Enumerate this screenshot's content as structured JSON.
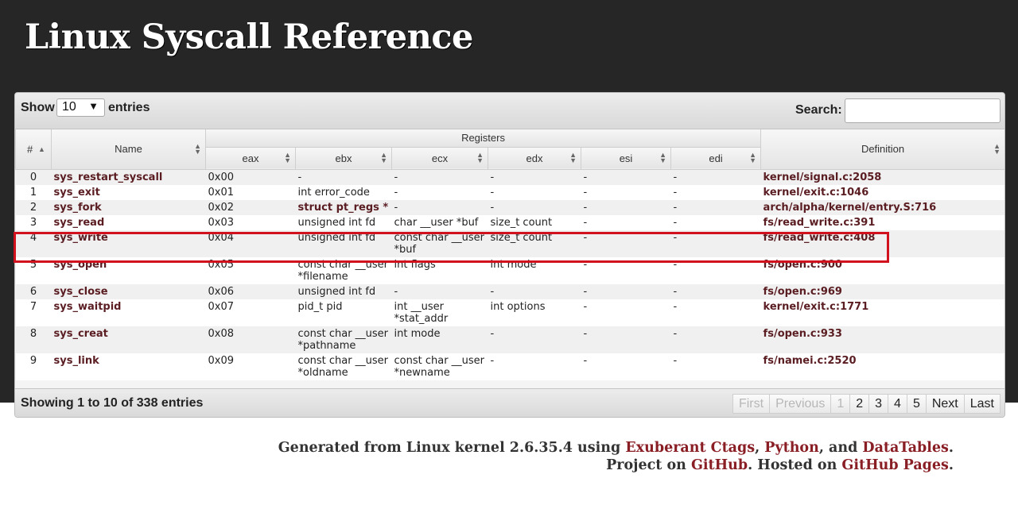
{
  "site": {
    "title": "Linux Syscall Reference"
  },
  "toolbar": {
    "show_label": "Show",
    "length_value": "10",
    "entries_label": "entries",
    "search_label": "Search:",
    "search_value": ""
  },
  "columns": {
    "num": "#",
    "name": "Name",
    "registers": "Registers",
    "eax": "eax",
    "ebx": "ebx",
    "ecx": "ecx",
    "edx": "edx",
    "esi": "esi",
    "edi": "edi",
    "definition": "Definition"
  },
  "rows": [
    {
      "num": "0",
      "name": "sys_restart_syscall",
      "eax": "0x00",
      "ebx": "-",
      "ecx": "-",
      "edx": "-",
      "esi": "-",
      "edi": "-",
      "def": "kernel/signal.c:2058"
    },
    {
      "num": "1",
      "name": "sys_exit",
      "eax": "0x01",
      "ebx": "int error_code",
      "ecx": "-",
      "edx": "-",
      "esi": "-",
      "edi": "-",
      "def": "kernel/exit.c:1046"
    },
    {
      "num": "2",
      "name": "sys_fork",
      "eax": "0x02",
      "ebx": "struct pt_regs *",
      "ecx": "-",
      "edx": "-",
      "esi": "-",
      "edi": "-",
      "def": "arch/alpha/kernel/entry.S:716"
    },
    {
      "num": "3",
      "name": "sys_read",
      "eax": "0x03",
      "ebx": "unsigned int fd",
      "ecx": "char __user *buf",
      "edx": "size_t count",
      "esi": "-",
      "edi": "-",
      "def": "fs/read_write.c:391"
    },
    {
      "num": "4",
      "name": "sys_write",
      "eax": "0x04",
      "ebx": "unsigned int fd",
      "ecx": "const char __user *buf",
      "edx": "size_t count",
      "esi": "-",
      "edi": "-",
      "def": "fs/read_write.c:408"
    },
    {
      "num": "5",
      "name": "sys_open",
      "eax": "0x05",
      "ebx": "const char __user *filename",
      "ecx": "int flags",
      "edx": "int mode",
      "esi": "-",
      "edi": "-",
      "def": "fs/open.c:900"
    },
    {
      "num": "6",
      "name": "sys_close",
      "eax": "0x06",
      "ebx": "unsigned int fd",
      "ecx": "-",
      "edx": "-",
      "esi": "-",
      "edi": "-",
      "def": "fs/open.c:969"
    },
    {
      "num": "7",
      "name": "sys_waitpid",
      "eax": "0x07",
      "ebx": "pid_t pid",
      "ecx": "int __user *stat_addr",
      "edx": "int options",
      "esi": "-",
      "edi": "-",
      "def": "kernel/exit.c:1771"
    },
    {
      "num": "8",
      "name": "sys_creat",
      "eax": "0x08",
      "ebx": "const char __user *pathname",
      "ecx": "int mode",
      "edx": "-",
      "esi": "-",
      "edi": "-",
      "def": "fs/open.c:933"
    },
    {
      "num": "9",
      "name": "sys_link",
      "eax": "0x09",
      "ebx": "const char __user *oldname",
      "ecx": "const char __user *newname",
      "edx": "-",
      "esi": "-",
      "edi": "-",
      "def": "fs/namei.c:2520"
    }
  ],
  "footer": {
    "info": "Showing 1 to 10 of 338 entries",
    "pages": [
      {
        "label": "First",
        "disabled": true
      },
      {
        "label": "Previous",
        "disabled": true
      },
      {
        "label": "1",
        "disabled": true
      },
      {
        "label": "2",
        "disabled": false
      },
      {
        "label": "3",
        "disabled": false
      },
      {
        "label": "4",
        "disabled": false
      },
      {
        "label": "5",
        "disabled": false
      },
      {
        "label": "Next",
        "disabled": false
      },
      {
        "label": "Last",
        "disabled": false
      }
    ]
  },
  "credits": {
    "line1_prefix": "Generated from Linux kernel 2.6.35.4 using ",
    "link_ctags": "Exuberant Ctags",
    "sep1": ", ",
    "link_python": "Python",
    "sep2": ", and ",
    "link_datatables": "DataTables",
    "line1_suffix": ".",
    "line2_prefix": "Project on ",
    "link_github": "GitHub",
    "line2_mid": ". Hosted on ",
    "link_pages": "GitHub Pages",
    "line2_suffix": "."
  },
  "colors": {
    "band": "#262626",
    "accent": "#5a1d22",
    "link": "#8a1e25",
    "highlight": "#d1121e"
  }
}
